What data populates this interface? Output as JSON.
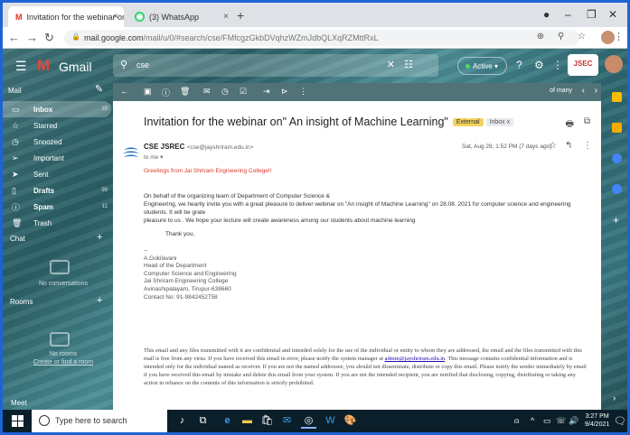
{
  "browser": {
    "tabs": [
      {
        "label": "Invitation for the webinar on\" An",
        "icon": "gmail-icon",
        "close": "×"
      },
      {
        "label": "(3) WhatsApp",
        "icon": "whatsapp-icon",
        "close": "×"
      }
    ],
    "new_tab": "+",
    "url_host": "mail.google.com",
    "url_path": "/mail/u/0/#search/cse/FMfcgzGkbDVqhzWZmJdbQLXqRZMttRxL"
  },
  "gmail": {
    "logo_text": "Gmail",
    "search_value": "cse",
    "status": "Active",
    "status_caret": "▾",
    "badge_text": "JSEC"
  },
  "sidebar": {
    "header": "Mail",
    "items": [
      {
        "label": "Inbox",
        "count": "39",
        "icon": "inbox-icon"
      },
      {
        "label": "Starred",
        "count": "",
        "icon": "star-icon"
      },
      {
        "label": "Snoozed",
        "count": "",
        "icon": "clock-icon"
      },
      {
        "label": "Important",
        "count": "",
        "icon": "important-icon"
      },
      {
        "label": "Sent",
        "count": "",
        "icon": "send-icon"
      },
      {
        "label": "Drafts",
        "count": "99",
        "icon": "draft-icon"
      },
      {
        "label": "Spam",
        "count": "11",
        "icon": "spam-icon"
      },
      {
        "label": "Trash",
        "count": "",
        "icon": "trash-icon"
      }
    ],
    "chat_title": "Chat",
    "chat_empty": "No conversations",
    "rooms_title": "Rooms",
    "rooms_empty": "No rooms",
    "rooms_link": "Create or find a room",
    "meet_title": "Meet"
  },
  "toolbar": {
    "pager": "of many"
  },
  "email": {
    "subject": "Invitation for the webinar on\" An insight of Machine Learning\"",
    "tag_external": "External",
    "tag_inbox": "Inbox x",
    "sender_name": "CSE JSREC",
    "sender_addr": "<cse@jayshriram.edu.in>",
    "to": "to me",
    "date": "Sat, Aug 28, 1:52 PM (7 days ago)",
    "greeting": "Greetings from Jai Shriram Engineering College!!",
    "para1_l1": "On behalf of the organizing team of Department of Computer Science &",
    "para1_l2": "Engineering, we heartly invite you with a great pleasure to deliver webinar on \"An insight of Machine Learning\" on 28.08. 2021 for computer science and engineering students. It will be grate",
    "para1_l3": "pleasure to us . We hope your lecture will create awareness among our students about machine learning",
    "thanks": "Thank you,",
    "sig_dash": "--",
    "sig_name": "A.Gokilavani",
    "sig_title": "Head of the Department",
    "sig_dept": "Computer Science and Engineering",
    "sig_college": "Jai Shriram Engineering College",
    "sig_addr": "Avinashipalayam, Tirupur-638660",
    "sig_contact": "Contact No: 91-9842452758",
    "disc_l1": "This email and any files transmitted with it are confidential and intended solely for the use of the individual or entity to whom they are addressed, the email and the files transmitted with this",
    "disc_l2a": "mail is free from any virus. If you have received this email in error, please notify the system manager at ",
    "disc_link": "admin@jayshriram.edu.in",
    "disc_l2b": ". This message contains confidential information and is",
    "disc_l3": "intended only for the individual named as receiver. If you are not the named addressee, you should not disseminate, distribute or copy this email. Please notify the sender immediately by email",
    "disc_l4": "if you have received this email by mistake and delete this email from your system. If you are not the intended recipient, you are notified that disclosing, copying, distributing or taking any",
    "disc_l5": "action in reliance on the contents of this information is strictly prohibited."
  },
  "taskbar": {
    "search_placeholder": "Type here to search",
    "time": "3:27 PM",
    "date": "9/4/2021"
  },
  "colors": {
    "frame": "#1e63d6",
    "greeting": "#d83a2e",
    "tag_external": "#f4d35e"
  }
}
